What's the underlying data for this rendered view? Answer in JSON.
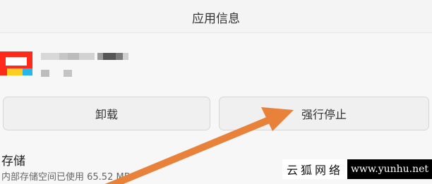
{
  "header": {
    "title": "应用信息"
  },
  "app": {
    "icon": "app-icon"
  },
  "actions": {
    "uninstall_label": "卸载",
    "force_stop_label": "强行停止"
  },
  "storage": {
    "title": "存储",
    "detail": "内部存储空间已使用 65.52 MB"
  },
  "watermark": {
    "cn": "云狐网络",
    "url": "www.yunhu.net"
  },
  "annotation": {
    "arrow_color": "#e8823a"
  }
}
